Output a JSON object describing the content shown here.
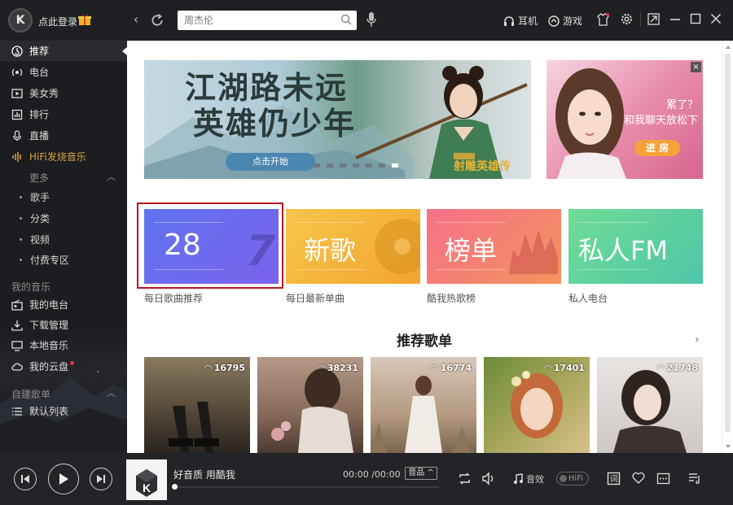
{
  "header": {
    "logo_text": "K",
    "login_label": "点此登录",
    "search_placeholder": "周杰伦",
    "earphone_label": "耳机",
    "game_label": "游戏"
  },
  "sidebar": {
    "items": [
      {
        "label": "推荐",
        "icon": "recommend-icon"
      },
      {
        "label": "电台",
        "icon": "radio-icon"
      },
      {
        "label": "美女秀",
        "icon": "video-play-icon"
      },
      {
        "label": "排行",
        "icon": "chart-icon"
      },
      {
        "label": "直播",
        "icon": "mic-icon"
      },
      {
        "label": "HiFi发烧音乐",
        "icon": "hifi-icon"
      }
    ],
    "more_label": "更多",
    "sub_items": [
      "歌手",
      "分类",
      "视频",
      "付费专区"
    ],
    "my_music_heading": "我的音乐",
    "my_music_items": [
      {
        "label": "我的电台",
        "icon": "my-radio-icon"
      },
      {
        "label": "下载管理",
        "icon": "download-icon"
      },
      {
        "label": "本地音乐",
        "icon": "monitor-icon"
      },
      {
        "label": "我的云盘",
        "icon": "cloud-icon"
      }
    ],
    "custom_list_heading": "自建歌单",
    "custom_list_items": [
      {
        "label": "默认列表",
        "icon": "list-icon"
      }
    ]
  },
  "banner": {
    "title_line1": "江湖路未远",
    "title_line2": "英雄仍少年",
    "start_button": "点击开始",
    "signature": "射雕英雄传"
  },
  "ad": {
    "text_line1": "累了？",
    "text_line2": "和我聊天放松下",
    "button": "进 房",
    "close": "×"
  },
  "tiles": [
    {
      "label": "28",
      "caption": "每日歌曲推荐",
      "bg": "#6c6ff0"
    },
    {
      "label": "新歌",
      "caption": "每日最新单曲",
      "bg": "#f5b33a"
    },
    {
      "label": "榜单",
      "caption": "酷我热歌榜",
      "bg": "#f06c7c"
    },
    {
      "label": "私人FM",
      "caption": "私人电台",
      "bg": "#5fd39a"
    }
  ],
  "section": {
    "title": "推荐歌单",
    "arrow": "›"
  },
  "playlists": [
    {
      "count": "16795"
    },
    {
      "count": "38231"
    },
    {
      "count": "16774"
    },
    {
      "count": "17401"
    },
    {
      "count": "21748"
    }
  ],
  "player": {
    "song_title": "好音质 用酷我",
    "time": "00:00 /00:00",
    "quality": "音品 ^",
    "effect_label": "音效",
    "hifi_label": "HiFi",
    "progress_fraction": 0.0
  }
}
